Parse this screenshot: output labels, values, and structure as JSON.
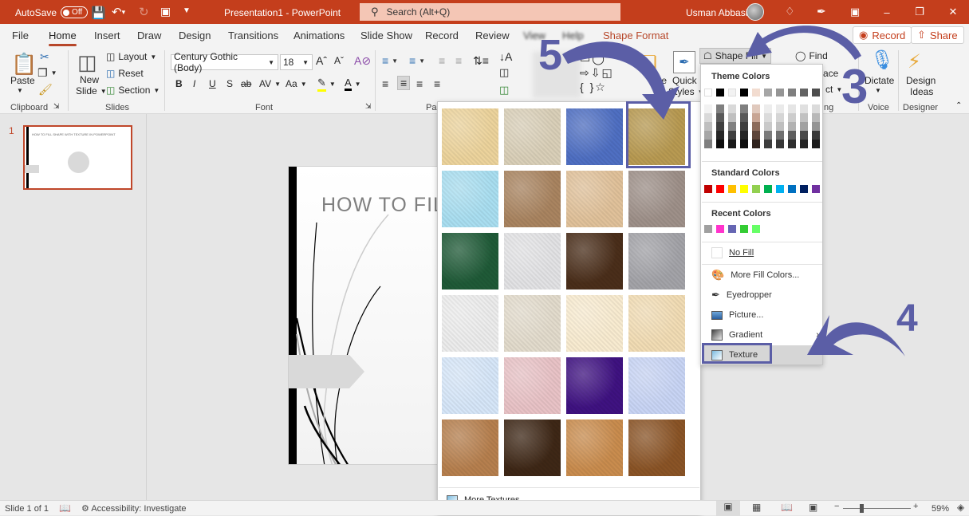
{
  "titlebar": {
    "autosave_label": "AutoSave",
    "autosave_state": "Off",
    "title": "Presentation1  -  PowerPoint",
    "search_placeholder": "Search (Alt+Q)",
    "user_name": "Usman Abbasi"
  },
  "tabs": [
    "File",
    "Home",
    "Insert",
    "Draw",
    "Design",
    "Transitions",
    "Animations",
    "Slide Show",
    "Record",
    "Review",
    "View",
    "Help",
    "Shape Format"
  ],
  "active_tab": "Home",
  "header_buttons": {
    "record": "Record",
    "share": "Share"
  },
  "ribbon": {
    "clipboard": {
      "label": "Clipboard",
      "paste": "Paste"
    },
    "slides": {
      "label": "Slides",
      "new_slide_1": "New",
      "new_slide_2": "Slide",
      "layout": "Layout",
      "reset": "Reset",
      "section": "Section"
    },
    "font": {
      "label": "Font",
      "font_name": "Century Gothic (Body)",
      "font_size": "18",
      "bold": "B",
      "italic": "I",
      "underline": "U",
      "shadow": "S",
      "strike": "ab",
      "spacing": "AV",
      "case": "Aa"
    },
    "paragraph": {
      "label": "Par"
    },
    "drawing": {
      "arrange": "nge",
      "quick_styles_1": "Quick",
      "quick_styles_2": "Styles",
      "shape_fill": "Shape Fill"
    },
    "editing": {
      "find": "Find",
      "replace": "ace",
      "select": "ct",
      "label": "ng"
    },
    "voice": {
      "label": "Voice",
      "dictate": "Dictate"
    },
    "designer": {
      "label": "Designer",
      "design_ideas_1": "Design",
      "design_ideas_2": "Ideas"
    }
  },
  "slide_panel": {
    "slide_number": "1",
    "thumb_title": "HOW TO FILL SHAPE WITH TEXTURE IN POWERPOINT"
  },
  "slide": {
    "title": "HOW TO FILL"
  },
  "texture_gallery": {
    "textures": [
      {
        "name": "Papyrus",
        "color": "#ecd39c"
      },
      {
        "name": "Canvas",
        "color": "#d9cfb8"
      },
      {
        "name": "Denim",
        "color": "#4f6fc2"
      },
      {
        "name": "Woven mat",
        "color": "#b89a52"
      },
      {
        "name": "Water droplets",
        "color": "#a9def0"
      },
      {
        "name": "Paper bag",
        "color": "#a98460"
      },
      {
        "name": "Fish fossil",
        "color": "#e0c19a"
      },
      {
        "name": "Sand",
        "color": "#9e9089"
      },
      {
        "name": "Green marble",
        "color": "#1f5a37"
      },
      {
        "name": "White marble",
        "color": "#e2e2e4"
      },
      {
        "name": "Brown marble",
        "color": "#4a2e1a"
      },
      {
        "name": "Granite",
        "color": "#a3a3a8"
      },
      {
        "name": "Newsprint",
        "color": "#ececec"
      },
      {
        "name": "Recycled paper",
        "color": "#e2dbcc"
      },
      {
        "name": "Parchment",
        "color": "#f8ebd0"
      },
      {
        "name": "Stationery",
        "color": "#f1dcb4"
      },
      {
        "name": "Blue tissue paper",
        "color": "#d6e6f8"
      },
      {
        "name": "Pink tissue paper",
        "color": "#e8c2c6"
      },
      {
        "name": "Purple mesh",
        "color": "#3f1281"
      },
      {
        "name": "Bouquet",
        "color": "#c8d4f4"
      },
      {
        "name": "Cork",
        "color": "#b67f4e"
      },
      {
        "name": "Walnut",
        "color": "#3e2716"
      },
      {
        "name": "Oak",
        "color": "#c98c4e"
      },
      {
        "name": "Medium wood",
        "color": "#8a5426"
      }
    ],
    "selected_index": 3,
    "more_textures": "More Textures..."
  },
  "fill_menu": {
    "theme_colors_label": "Theme Colors",
    "theme_row": [
      "#ffffff",
      "#000000",
      "#f2f2f2",
      "#000000",
      "#f2dcd0",
      "#a6a6a6",
      "#959595",
      "#7f7f7f",
      "#636363",
      "#4d4d4d"
    ],
    "standard_colors_label": "Standard Colors",
    "standard_colors": [
      "#c00000",
      "#ff0000",
      "#ffc000",
      "#ffff00",
      "#92d050",
      "#00b050",
      "#00b0f0",
      "#0070c0",
      "#002060",
      "#7030a0"
    ],
    "recent_colors_label": "Recent Colors",
    "recent_colors": [
      "#a0a0a0",
      "#ff33cc",
      "#6666b3",
      "#33cc33",
      "#66ff66"
    ],
    "items": {
      "no_fill": "No Fill",
      "more_fill_colors": "More Fill Colors...",
      "eyedropper": "Eyedropper",
      "picture": "Picture...",
      "gradient": "Gradient",
      "texture": "Texture"
    }
  },
  "annotations": {
    "step3": "3",
    "step4": "4",
    "step5": "5",
    "color": "#5b5ea6"
  },
  "statusbar": {
    "slide_info": "Slide 1 of 1",
    "accessibility": "Accessibility: Investigate",
    "zoom": "59%"
  }
}
